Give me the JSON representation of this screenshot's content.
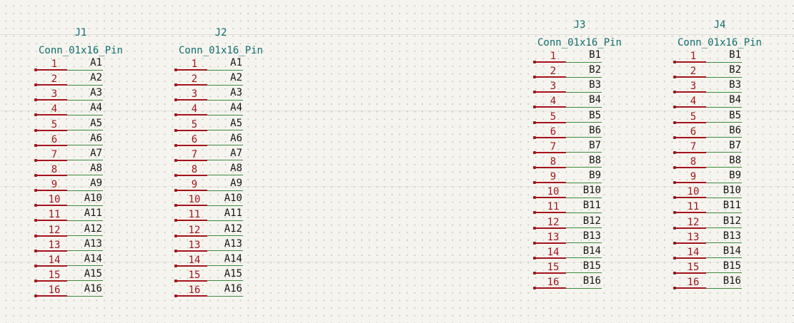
{
  "symbols": [
    {
      "ref": "J1",
      "value": "Conn_01x16_Pin",
      "pins": [
        {
          "number": "1",
          "name": "A1"
        },
        {
          "number": "2",
          "name": "A2"
        },
        {
          "number": "3",
          "name": "A3"
        },
        {
          "number": "4",
          "name": "A4"
        },
        {
          "number": "5",
          "name": "A5"
        },
        {
          "number": "6",
          "name": "A6"
        },
        {
          "number": "7",
          "name": "A7"
        },
        {
          "number": "8",
          "name": "A8"
        },
        {
          "number": "9",
          "name": "A9"
        },
        {
          "number": "10",
          "name": "A10"
        },
        {
          "number": "11",
          "name": "A11"
        },
        {
          "number": "12",
          "name": "A12"
        },
        {
          "number": "13",
          "name": "A13"
        },
        {
          "number": "14",
          "name": "A14"
        },
        {
          "number": "15",
          "name": "A15"
        },
        {
          "number": "16",
          "name": "A16"
        }
      ]
    },
    {
      "ref": "J2",
      "value": "Conn_01x16_Pin",
      "pins": [
        {
          "number": "1",
          "name": "A1"
        },
        {
          "number": "2",
          "name": "A2"
        },
        {
          "number": "3",
          "name": "A3"
        },
        {
          "number": "4",
          "name": "A4"
        },
        {
          "number": "5",
          "name": "A5"
        },
        {
          "number": "6",
          "name": "A6"
        },
        {
          "number": "7",
          "name": "A7"
        },
        {
          "number": "8",
          "name": "A8"
        },
        {
          "number": "9",
          "name": "A9"
        },
        {
          "number": "10",
          "name": "A10"
        },
        {
          "number": "11",
          "name": "A11"
        },
        {
          "number": "12",
          "name": "A12"
        },
        {
          "number": "13",
          "name": "A13"
        },
        {
          "number": "14",
          "name": "A14"
        },
        {
          "number": "15",
          "name": "A15"
        },
        {
          "number": "16",
          "name": "A16"
        }
      ]
    },
    {
      "ref": "J3",
      "value": "Conn_01x16_Pin",
      "pins": [
        {
          "number": "1",
          "name": "B1"
        },
        {
          "number": "2",
          "name": "B2"
        },
        {
          "number": "3",
          "name": "B3"
        },
        {
          "number": "4",
          "name": "B4"
        },
        {
          "number": "5",
          "name": "B5"
        },
        {
          "number": "6",
          "name": "B6"
        },
        {
          "number": "7",
          "name": "B7"
        },
        {
          "number": "8",
          "name": "B8"
        },
        {
          "number": "9",
          "name": "B9"
        },
        {
          "number": "10",
          "name": "B10"
        },
        {
          "number": "11",
          "name": "B11"
        },
        {
          "number": "12",
          "name": "B12"
        },
        {
          "number": "13",
          "name": "B13"
        },
        {
          "number": "14",
          "name": "B14"
        },
        {
          "number": "15",
          "name": "B15"
        },
        {
          "number": "16",
          "name": "B16"
        }
      ]
    },
    {
      "ref": "J4",
      "value": "Conn_01x16_Pin",
      "pins": [
        {
          "number": "1",
          "name": "B1"
        },
        {
          "number": "2",
          "name": "B2"
        },
        {
          "number": "3",
          "name": "B3"
        },
        {
          "number": "4",
          "name": "B4"
        },
        {
          "number": "5",
          "name": "B5"
        },
        {
          "number": "6",
          "name": "B6"
        },
        {
          "number": "7",
          "name": "B7"
        },
        {
          "number": "8",
          "name": "B8"
        },
        {
          "number": "9",
          "name": "B9"
        },
        {
          "number": "10",
          "name": "B10"
        },
        {
          "number": "11",
          "name": "B11"
        },
        {
          "number": "12",
          "name": "B12"
        },
        {
          "number": "13",
          "name": "B13"
        },
        {
          "number": "14",
          "name": "B14"
        },
        {
          "number": "15",
          "name": "B15"
        },
        {
          "number": "16",
          "name": "B16"
        }
      ]
    }
  ]
}
